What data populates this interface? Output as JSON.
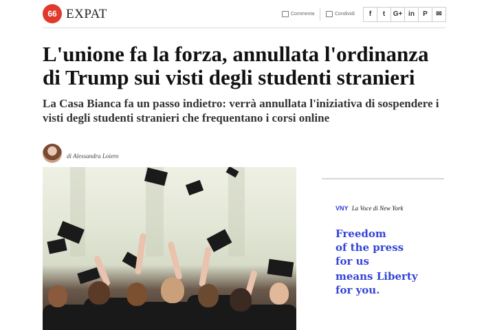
{
  "header": {
    "logo_badge": "66",
    "logo_text": "EXPAT",
    "comment_label": "Commenta",
    "share_label": "Condividi",
    "social_icons": [
      {
        "name": "facebook-icon",
        "glyph": "f"
      },
      {
        "name": "twitter-icon",
        "glyph": "t"
      },
      {
        "name": "google-plus-icon",
        "glyph": "G+"
      },
      {
        "name": "linkedin-icon",
        "glyph": "in"
      },
      {
        "name": "pinterest-icon",
        "glyph": "P"
      },
      {
        "name": "email-icon",
        "glyph": "✉"
      }
    ]
  },
  "article": {
    "headline": "L'unione fa la forza, annullata l'ordinanza di Trump sui visti degli studenti stranieri",
    "dek": "La Casa Bianca fa un passo indietro: verrà annullata l'iniziativa di sospendere i visti degli studenti stranieri che frequentano i corsi online",
    "byline": "di Alessandra Loiero"
  },
  "ad": {
    "brand_mark": "VNY",
    "brand_name": "La Voce di New York",
    "lines": [
      "Freedom",
      "of the press",
      "for us",
      "means Liberty",
      "for you."
    ]
  },
  "colors": {
    "brand_red": "#e03a2f",
    "ad_blue": "#3444d6"
  }
}
